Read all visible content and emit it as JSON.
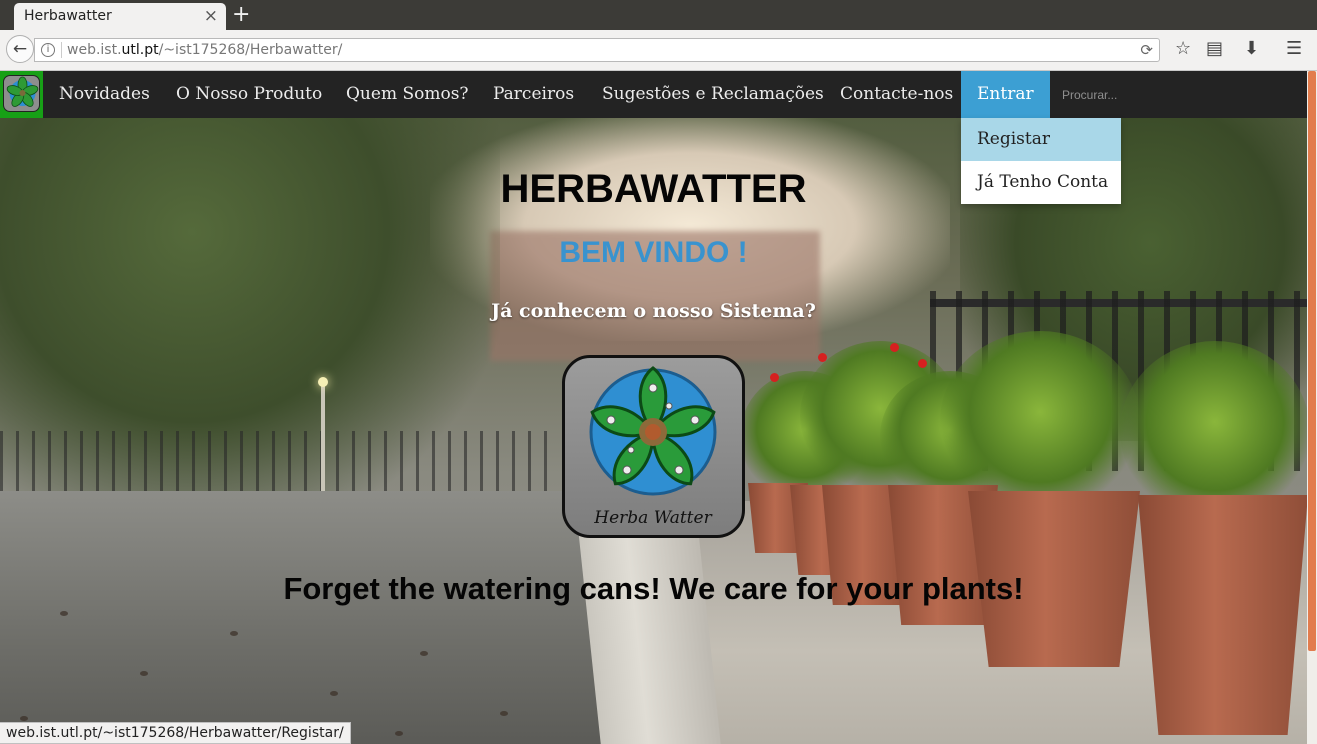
{
  "browser": {
    "tab_title": "Herbawatter",
    "tab_close": "×",
    "new_tab": "+",
    "back_glyph": "←",
    "info_glyph": "i",
    "url_prefix": "web.ist.",
    "url_domain": "utl.pt",
    "url_path": "/~ist175268/Herbawatter/",
    "reload_glyph": "⟳",
    "toolbar_icons": [
      "star-icon",
      "reading-list-icon",
      "download-icon",
      "menu-icon"
    ],
    "star_glyph": "☆",
    "reading_glyph": "▤",
    "download_glyph": "⬇",
    "menu_glyph": "☰",
    "status_url": "web.ist.utl.pt/~ist175268/Herbawatter/Registar/"
  },
  "nav": {
    "items": [
      "Novidades",
      "O Nosso Produto",
      "Quem Somos?",
      "Parceiros",
      "Sugestões e Reclamações",
      "Contacte-nos"
    ],
    "active": "Entrar",
    "search_placeholder": "Procurar...",
    "dropdown": [
      "Registar",
      "Já Tenho Conta"
    ]
  },
  "hero": {
    "title": "HERBAWATTER",
    "welcome": "BEM VINDO !",
    "question": "Já conhecem o nosso Sistema?",
    "logo_text": "Herba Watter",
    "tagline": "Forget the watering cans! We care for your plants!"
  },
  "colors": {
    "navbar": "#232323",
    "active_nav": "#3c9fd3",
    "dropdown_highlight": "#a9d7e8",
    "logo_bg": "#17a016",
    "welcome": "#3993cf",
    "scroll_thumb": "#e27c4d"
  }
}
